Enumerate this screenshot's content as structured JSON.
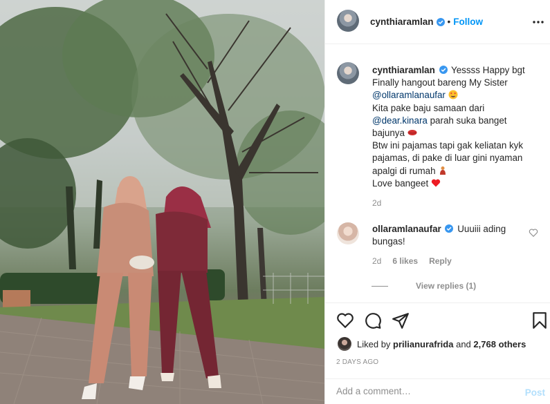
{
  "post": {
    "author": "cynthiaramlan",
    "follow_label": "Follow",
    "separator": "•"
  },
  "caption": {
    "username": "cynthiaramlan",
    "lines": [
      "Yessss Happy bgt",
      "Finally hangout bareng My Sister",
      "@ollaramlanaufar",
      "Kita pake baju samaan dari",
      "@dear.kinara",
      "parah suka banget",
      "bajunya",
      "Btw ini pajamas tapi gak keliatan kyk",
      "pajamas, di pake di luar gini nyaman",
      "apalgi di rumah",
      "Love bangeet"
    ],
    "age": "2d"
  },
  "comment": {
    "username": "ollaramlanaufar",
    "text_line1": "Uuuiii ading",
    "text_line2": "bungas!",
    "age": "2d",
    "likes": "6 likes",
    "reply_label": "Reply",
    "view_replies": "View replies (1)"
  },
  "likes": {
    "prefix": "Liked by",
    "user": "prilianurafrida",
    "connector": "and",
    "others": "2,768 others"
  },
  "timestamp": "2 DAYS AGO",
  "add_comment": {
    "placeholder": "Add a comment…",
    "post_label": "Post"
  },
  "icons": {
    "verified": "verified-badge-icon",
    "more": "more-options-icon",
    "like": "heart-icon",
    "comment": "comment-icon",
    "share": "share-icon",
    "save": "bookmark-icon"
  },
  "colors": {
    "accent": "#0095f6",
    "verified": "#3897f0",
    "mention": "#00376b",
    "muted": "#8e8e8e",
    "emoji_heart": "#ed1c24"
  }
}
